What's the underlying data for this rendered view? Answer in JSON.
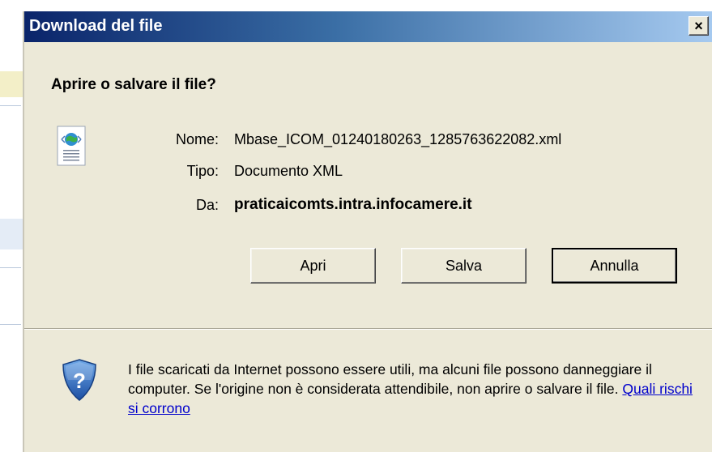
{
  "dialog": {
    "title": "Download del file",
    "close_glyph": "×",
    "heading": "Aprire o salvare il file?",
    "file_icon": "xml-document-icon",
    "info": {
      "name_label": "Nome:",
      "name_value": "Mbase_ICOM_01240180263_1285763622082.xml",
      "type_label": "Tipo:",
      "type_value": "Documento XML",
      "from_label": "Da:",
      "from_value": "praticaicomts.intra.infocamere.it"
    },
    "buttons": {
      "open": "Apri",
      "save": "Salva",
      "cancel": "Annulla"
    },
    "warning": {
      "icon": "security-shield-question-icon",
      "text": "I file scaricati da Internet possono essere utili, ma alcuni file possono danneggiare il computer. Se l'origine non è considerata attendibile, non aprire o salvare il file.",
      "link": "Quali rischi si corrono"
    }
  },
  "colors": {
    "title_gradient_start": "#0a246a",
    "title_gradient_end": "#a6caf0",
    "dialog_background": "#ece9d8",
    "link": "#0000cc"
  }
}
